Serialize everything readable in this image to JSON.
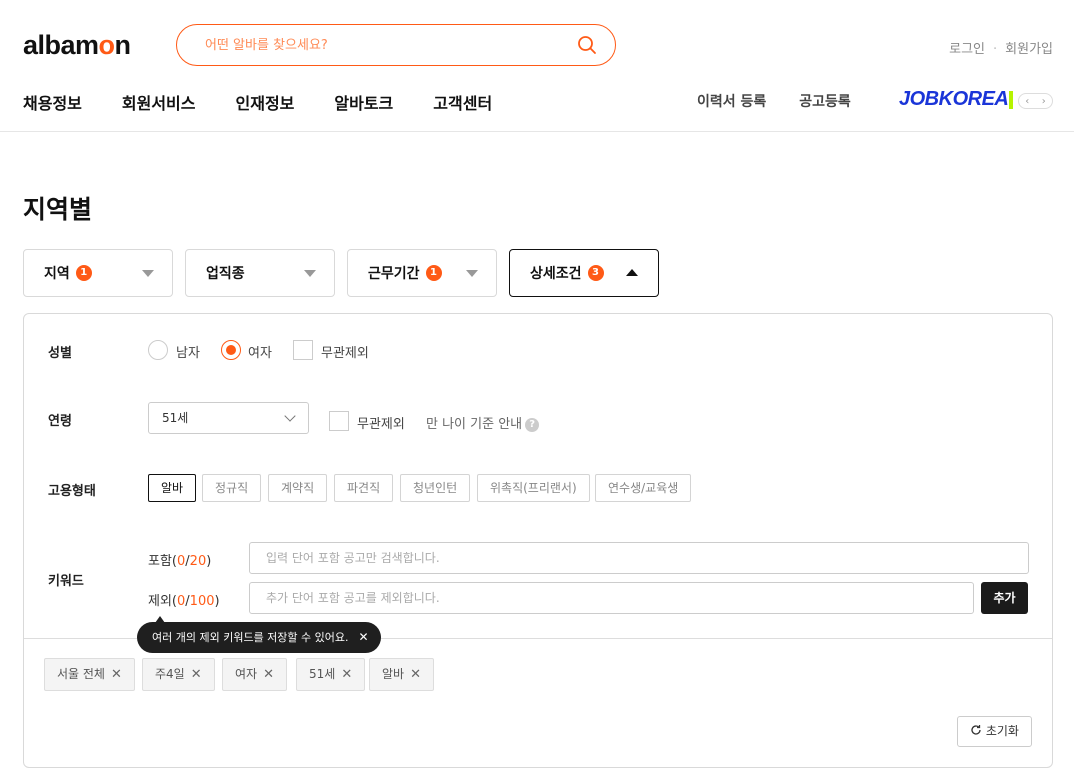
{
  "header": {
    "logo_prefix": "albam",
    "logo_o": "o",
    "logo_suffix": "n",
    "search_placeholder": "어떤 알바를 찾으세요?",
    "login": "로그인",
    "separator": "·",
    "signup": "회원가입",
    "brand_color": "#ff5a16"
  },
  "gnb": [
    "채용정보",
    "회원서비스",
    "인재정보",
    "알바토크",
    "고객센터"
  ],
  "right_nav": [
    "이력서 등록",
    "공고등록"
  ],
  "jobkorea": "JOBKOREA",
  "pager": {
    "prev": "‹",
    "next": "›"
  },
  "page_title": "지역별",
  "filter_tabs": [
    {
      "label": "지역",
      "badge": "1"
    },
    {
      "label": "업직종",
      "badge": ""
    },
    {
      "label": "근무기간",
      "badge": "1"
    },
    {
      "label": "상세조건",
      "badge": "3"
    }
  ],
  "panel": {
    "gender": {
      "label": "성별",
      "options": [
        "남자",
        "여자"
      ],
      "selected": "여자",
      "no_matter": "무관제외"
    },
    "age": {
      "label": "연령",
      "selected": "51세",
      "no_matter": "무관제외",
      "guide": "만 나이 기준 안내",
      "info_icon": "?"
    },
    "employment": {
      "label": "고용형태",
      "types": [
        "알바",
        "정규직",
        "계약직",
        "파견직",
        "청년인턴",
        "위촉직(프리랜서)",
        "연수생/교육생"
      ],
      "selected": "알바"
    },
    "keyword": {
      "label": "키워드",
      "include_label": "포함",
      "include_current": "0",
      "include_max": "20",
      "include_placeholder": "입력 단어 포함 공고만 검색합니다.",
      "exclude_label": "제외",
      "exclude_current": "0",
      "exclude_max": "100",
      "exclude_placeholder": "추가 단어 포함 공고를 제외합니다.",
      "add_button": "추가",
      "tooltip": "여러 개의 제외 키워드를 저장할 수 있어요."
    },
    "selected_tags": [
      "서울 전체",
      "주4일",
      "여자",
      "51세",
      "알바"
    ],
    "reset_button": "초기화"
  }
}
